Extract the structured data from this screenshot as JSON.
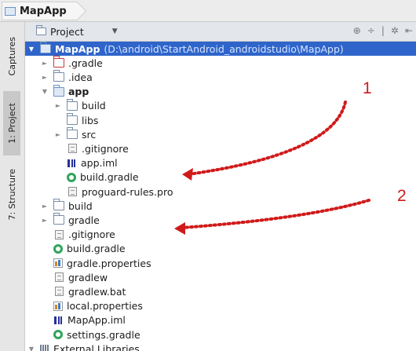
{
  "breadcrumb": {
    "project_name": "MapApp"
  },
  "side_tabs": [
    {
      "label": "Captures",
      "icon": "captures-icon"
    },
    {
      "label": "1: Project",
      "icon": "project-icon",
      "active": true
    },
    {
      "label": "7: Structure",
      "icon": "structure-icon"
    }
  ],
  "panel": {
    "view_selector": "Project"
  },
  "tree": [
    {
      "name": "MapApp",
      "note": "(D:\\android\\StartAndroid_androidstudio\\MapApp)",
      "icon": "module-folder",
      "depth": 0,
      "expanded": true,
      "selected": true,
      "bold": true
    },
    {
      "name": ".gradle",
      "icon": "folder-red",
      "depth": 1,
      "expanded": false
    },
    {
      "name": ".idea",
      "icon": "folder",
      "depth": 1,
      "expanded": false
    },
    {
      "name": "app",
      "icon": "module-folder",
      "depth": 1,
      "expanded": true,
      "bold": true
    },
    {
      "name": "build",
      "icon": "folder",
      "depth": 2,
      "expanded": false
    },
    {
      "name": "libs",
      "icon": "folder",
      "depth": 2
    },
    {
      "name": "src",
      "icon": "folder",
      "depth": 2,
      "expanded": false
    },
    {
      "name": ".gitignore",
      "icon": "file",
      "depth": 2
    },
    {
      "name": "app.iml",
      "icon": "iml",
      "depth": 2
    },
    {
      "name": "build.gradle",
      "icon": "gradle",
      "depth": 2
    },
    {
      "name": "proguard-rules.pro",
      "icon": "file",
      "depth": 2
    },
    {
      "name": "build",
      "icon": "folder",
      "depth": 1,
      "expanded": false
    },
    {
      "name": "gradle",
      "icon": "folder",
      "depth": 1,
      "expanded": false
    },
    {
      "name": ".gitignore",
      "icon": "file",
      "depth": 1
    },
    {
      "name": "build.gradle",
      "icon": "gradle",
      "depth": 1
    },
    {
      "name": "gradle.properties",
      "icon": "props",
      "depth": 1
    },
    {
      "name": "gradlew",
      "icon": "file",
      "depth": 1
    },
    {
      "name": "gradlew.bat",
      "icon": "file",
      "depth": 1
    },
    {
      "name": "local.properties",
      "icon": "props",
      "depth": 1
    },
    {
      "name": "MapApp.iml",
      "icon": "iml",
      "depth": 1
    },
    {
      "name": "settings.gradle",
      "icon": "gradle",
      "depth": 1
    },
    {
      "name": "External Libraries",
      "icon": "libs",
      "depth": 0,
      "expanded": true
    }
  ],
  "annotations": [
    {
      "label": "1",
      "color": "#d01a1a"
    },
    {
      "label": "2",
      "color": "#d01a1a"
    }
  ],
  "colors": {
    "selection": "#2f65ca",
    "annotation": "#d01a1a"
  }
}
